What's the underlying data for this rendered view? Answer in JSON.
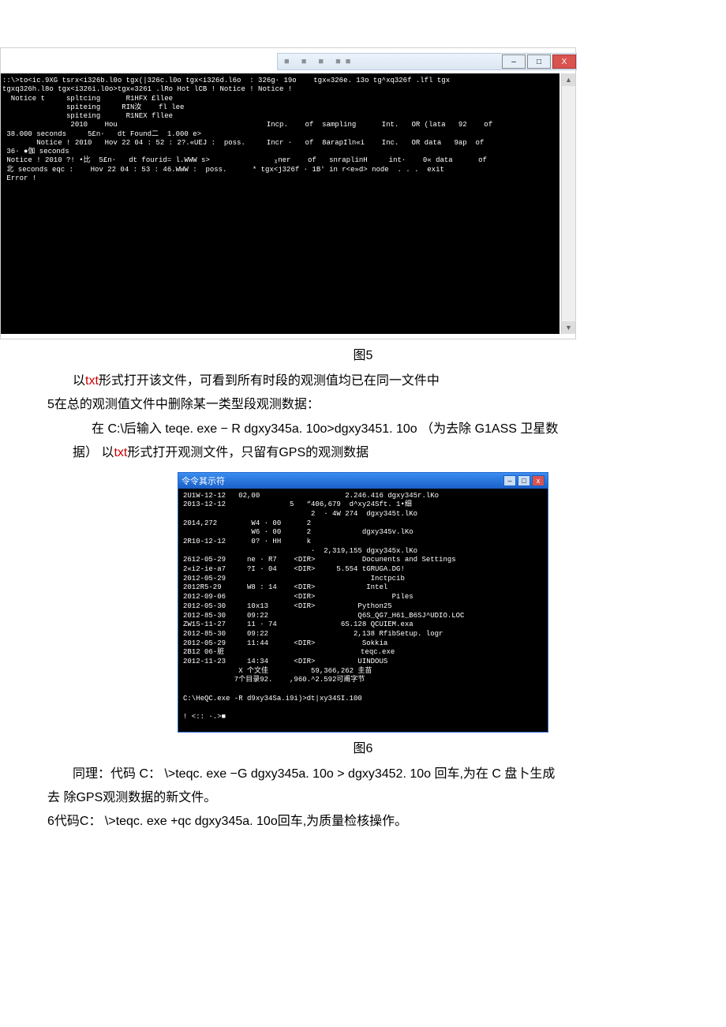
{
  "win5": {
    "menu": "■   ■   ■   ■■",
    "btn_min": "–",
    "btn_max": "□",
    "btn_close": "X",
    "terminal": "::\\>to<ic.9XG tsrx<i326b.l0o tgx(|326c.l0o tgx<i326d.l6o  : 326g· 19o    tgx«326e. 13o tg^xq326f .lfl tgx\ntgxq326h.l8o tgx<i326i.l0o>tgx«3261 .lRo Hot lCB ! Notice ! Notice !\n  Notice t     spltcing      R1HFX £llee\n               spiteing     RIN汝    fl lee\n               spiteing      R1NEX fllee\n                2010    Hou                                   Incp.    of  sampling      Int.   OR (lata   92    of\n 38.000 seconds     5£n·   dt Found二  1.000 e>\n        Notice ! 2010   Hov 22 04 : 52 : 2?.«UEJ :  poss.     Incr ·   of  8arapIln«i    Inc.   OR data   9ap  of\n 36· ●伽 seconds\n Notice ! 2010 ?! •比  5£n·   dt fourid= l.WWW s>               ᵪner    of   snraplinH     int·    0« data      of\n 北 seconds eqc :    Hov 22 04 : 53 : 46.WWW :  poss.      * tgx<j326f · 1B' in r<e»d> node  . . .  exit\n Error !\n"
  },
  "caption5": "图5",
  "p1": "以txt形式打开该文件，可看到所有时段的观测值均已在同一文件中",
  "p2": "5在总的观测值文件中删除某一类型段观测数据：",
  "p3_a": "在 C:\\后输入 teqe. exe − R dgxy345a. 10o>dgxy3451. 10o （为去除 G1ASS 卫星数",
  "p3_b": "据） 以txt形式打开观测文件，只留有GPS的观测数据",
  "win6": {
    "title": "令令其示符",
    "btn_min": "–",
    "btn_max": "□",
    "btn_close": "x",
    "terminal": "2U1W-12-12   02,00                    2.246.416 dgxy345r.lKo\n2013-12-12               5   “406,679  d^xy24Sft. 1•细\n                              2  · 4W 274  dgxy345t.lKo\n2014,272        W4 · 00      2\n                W6 · 00      2            dgxy345v.lKo\n2R10-12-12      0? · HH      k\n                              ·  2,319,155 dgxy345x.lKo\n2612-05-29     ne · R7    <DIR>           Docunents and Settings\n2«i2-ie-a7     ?I · 04    <DIR>     5.554 tGRUGA.DG!\n2012-05-29                                  Inctpcib\n2012R5-29      W8 : 14    <DIR>            Intel\n2012-09-06                <DIR>                  Piles\n2012-05-30     10x13      <DIR>          Python25\n2012-85-30     09:22                     Q6S_QG7_H61_B6SJ^UDIO.LOC\nZW1S-11-27     11 · 74               6S.128 QCUIEM.exa\n2012-85-30     09:22                    2,138 RfibSetup. logr\n2012-05-29     11:44      <DIR>           Sokkia\n2B12 06-脏                                teqc.exe\n2012-11-23     14:34      <DIR>          UINDOUS\n             X 个文佳          59,366,262 圭苗\n            7个目录92.    ,960.^2.592可甫字节\n\nC:\\HeQC.exe -R d9xy34Sa.i9i)>dt|xy34SI.100\n\n! <:: ·.>■\n"
  },
  "caption6": "图6",
  "p4_a": "同理：代码 C： \\>teqc. exe −G dgxy345a. 10o > dgxy3452. 10o 回车,为在 C 盘卜生成",
  "p4_b": "去 除GPS观测数据的新文件。",
  "p5": "6代码C： \\>teqc. exe +qc dgxy345a. 10o回车,为质量检核操作。"
}
